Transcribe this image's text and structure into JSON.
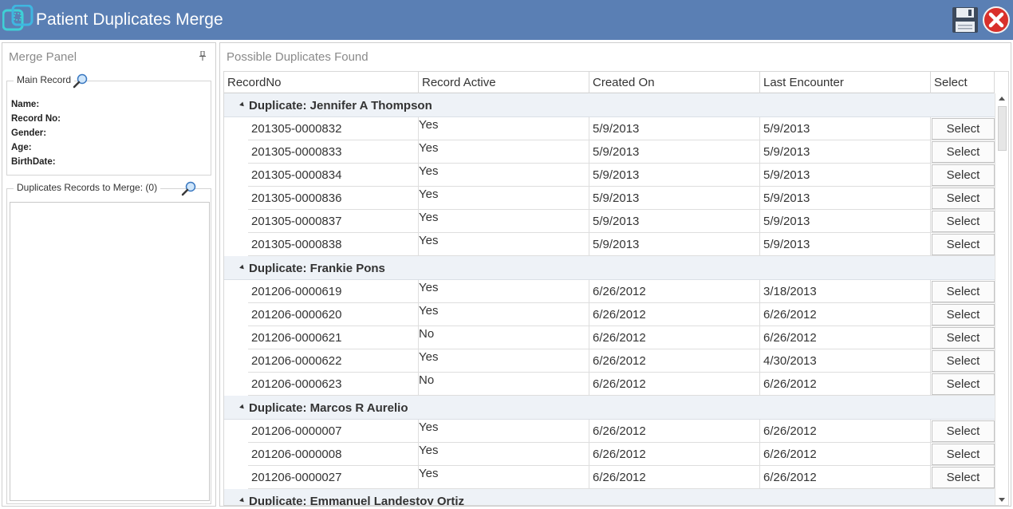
{
  "app": {
    "title": "Patient Duplicates Merge",
    "accent_color": "#5a7fb4"
  },
  "merge_panel": {
    "title": "Merge Panel",
    "main_record": {
      "legend": "Main Record",
      "fields": [
        "Name:",
        "Record No:",
        "Gender:",
        "Age:",
        "BirthDate:"
      ]
    },
    "duplicates_to_merge": {
      "legend": "Duplicates Records to Merge: (0)"
    }
  },
  "duplicates_panel": {
    "title": "Possible Duplicates Found",
    "columns": [
      "RecordNo",
      "Record Active",
      "Created On",
      "Last Encounter",
      "Select"
    ],
    "groups": [
      {
        "title": "Duplicate: Jennifer A Thompson",
        "rows": [
          {
            "record_no": "201305-0000832",
            "active": "Yes",
            "created": "5/9/2013",
            "last": "5/9/2013",
            "select": "Select"
          },
          {
            "record_no": "201305-0000833",
            "active": "Yes",
            "created": "5/9/2013",
            "last": "5/9/2013",
            "select": "Select"
          },
          {
            "record_no": "201305-0000834",
            "active": "Yes",
            "created": "5/9/2013",
            "last": "5/9/2013",
            "select": "Select"
          },
          {
            "record_no": "201305-0000836",
            "active": "Yes",
            "created": "5/9/2013",
            "last": "5/9/2013",
            "select": "Select"
          },
          {
            "record_no": "201305-0000837",
            "active": "Yes",
            "created": "5/9/2013",
            "last": "5/9/2013",
            "select": "Select"
          },
          {
            "record_no": "201305-0000838",
            "active": "Yes",
            "created": "5/9/2013",
            "last": "5/9/2013",
            "select": "Select"
          }
        ]
      },
      {
        "title": "Duplicate: Frankie Pons",
        "rows": [
          {
            "record_no": "201206-0000619",
            "active": "Yes",
            "created": "6/26/2012",
            "last": "3/18/2013",
            "select": "Select"
          },
          {
            "record_no": "201206-0000620",
            "active": "Yes",
            "created": "6/26/2012",
            "last": "6/26/2012",
            "select": "Select"
          },
          {
            "record_no": "201206-0000621",
            "active": "No",
            "created": "6/26/2012",
            "last": "6/26/2012",
            "select": "Select"
          },
          {
            "record_no": "201206-0000622",
            "active": "Yes",
            "created": "6/26/2012",
            "last": "4/30/2013",
            "select": "Select"
          },
          {
            "record_no": "201206-0000623",
            "active": "No",
            "created": "6/26/2012",
            "last": "6/26/2012",
            "select": "Select"
          }
        ]
      },
      {
        "title": "Duplicate: Marcos R Aurelio",
        "rows": [
          {
            "record_no": "201206-0000007",
            "active": "Yes",
            "created": "6/26/2012",
            "last": "6/26/2012",
            "select": "Select"
          },
          {
            "record_no": "201206-0000008",
            "active": "Yes",
            "created": "6/26/2012",
            "last": "6/26/2012",
            "select": "Select"
          },
          {
            "record_no": "201206-0000027",
            "active": "Yes",
            "created": "6/26/2012",
            "last": "6/26/2012",
            "select": "Select"
          }
        ]
      }
    ],
    "partial_group_title": "Duplicate: Emmanuel Landestoy Ortiz"
  }
}
